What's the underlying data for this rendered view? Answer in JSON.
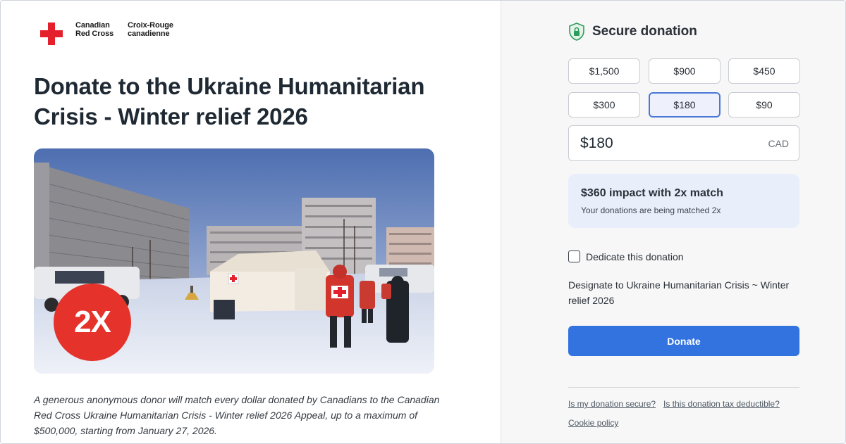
{
  "brand": {
    "name_en_line1": "Canadian",
    "name_en_line2": "Red Cross",
    "name_fr_line1": "Croix-Rouge",
    "name_fr_line2": "canadienne",
    "primary_color": "#e4202c"
  },
  "page": {
    "title": "Donate to the Ukraine Humanitarian Crisis - Winter relief 2026",
    "hero_badge": "2X",
    "match_description": "A generous anonymous donor will match every dollar donated by Canadians to the Canadian Red Cross Ukraine Humanitarian Crisis - Winter relief 2026 Appeal, up to a maximum of $500,000, starting from January 27, 2026."
  },
  "donation": {
    "secure_label": "Secure donation",
    "secure_icon": "shield-lock-icon",
    "amounts": [
      "$1,500",
      "$900",
      "$450",
      "$300",
      "$180",
      "$90"
    ],
    "selected_amount": "$180",
    "amount_value": "$180",
    "currency": "CAD",
    "impact_title": "$360 impact with 2x match",
    "impact_subtitle": "Your donations are being matched 2x",
    "dedicate_label": "Dedicate this donation",
    "dedicate_checked": false,
    "designation": "Designate to Ukraine Humanitarian Crisis ~ Winter relief 2026",
    "donate_label": "Donate",
    "accent_color": "#3273e0"
  },
  "footer": {
    "links": [
      "Is my donation secure?",
      "Is this donation tax deductible?",
      "Cookie policy"
    ]
  }
}
